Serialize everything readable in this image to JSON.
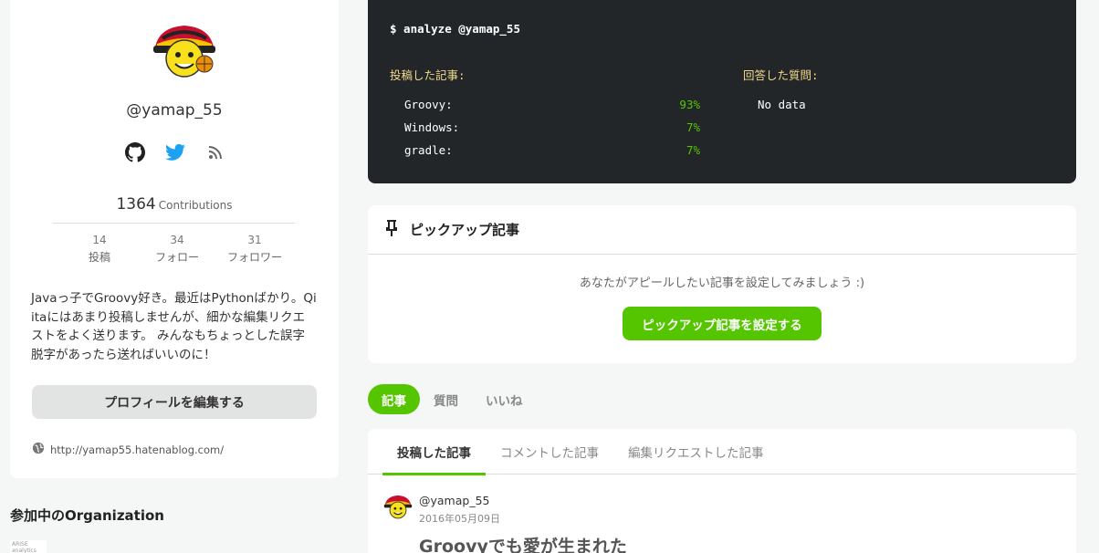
{
  "profile": {
    "username": "@yamap_55",
    "contributions_count": "1364",
    "contributions_label": "Contributions",
    "stats": [
      {
        "value": "14",
        "label": "投稿"
      },
      {
        "value": "34",
        "label": "フォロー"
      },
      {
        "value": "31",
        "label": "フォロワー"
      }
    ],
    "bio_lines": [
      "Javaっ子でGroovy好き。最近はPythonばかり。Qi",
      "itaにはあまり投稿しませんが、細かな編集リクエ",
      "ストをよく送ります。 みんなもちょっとした誤字",
      "脱字があったら送ればいいのに！"
    ],
    "edit_button": "プロフィールを編集する",
    "website": "http://yamap55.hatenablog.com/",
    "social_icons": [
      "github-icon",
      "twitter-icon",
      "rss-icon"
    ]
  },
  "organization": {
    "title": "参加中のOrganization",
    "logo_text_1": "ARISE",
    "logo_text_2": "analytics"
  },
  "terminal": {
    "command": "$ analyze @yamap_55",
    "posted_heading": "投稿した記事:",
    "answered_heading": "回答した質問:",
    "posted_rows": [
      {
        "name": "Groovy:",
        "pct": "93%"
      },
      {
        "name": "Windows:",
        "pct": "7%"
      },
      {
        "name": "gradle:",
        "pct": "7%"
      }
    ],
    "answered_value": "No data"
  },
  "pickup": {
    "title": "ピックアップ記事",
    "message": "あなたがアピールしたい記事を設定してみましょう :)",
    "button": "ピックアップ記事を設定する"
  },
  "tabs": [
    {
      "label": "記事",
      "active": true
    },
    {
      "label": "質問",
      "active": false
    },
    {
      "label": "いいね",
      "active": false
    }
  ],
  "subtabs": [
    {
      "label": "投稿した記事",
      "active": true
    },
    {
      "label": "コメントした記事",
      "active": false
    },
    {
      "label": "編集リクエストした記事",
      "active": false
    }
  ],
  "article": {
    "user": "@yamap_55",
    "date": "2016年05月09日",
    "title": "Groovyでも愛が生まれた"
  },
  "colors": {
    "accent": "#55c500",
    "terminal_bg": "#232628",
    "terminal_heading": "#f2d98a",
    "twitter": "#1da1f2"
  }
}
